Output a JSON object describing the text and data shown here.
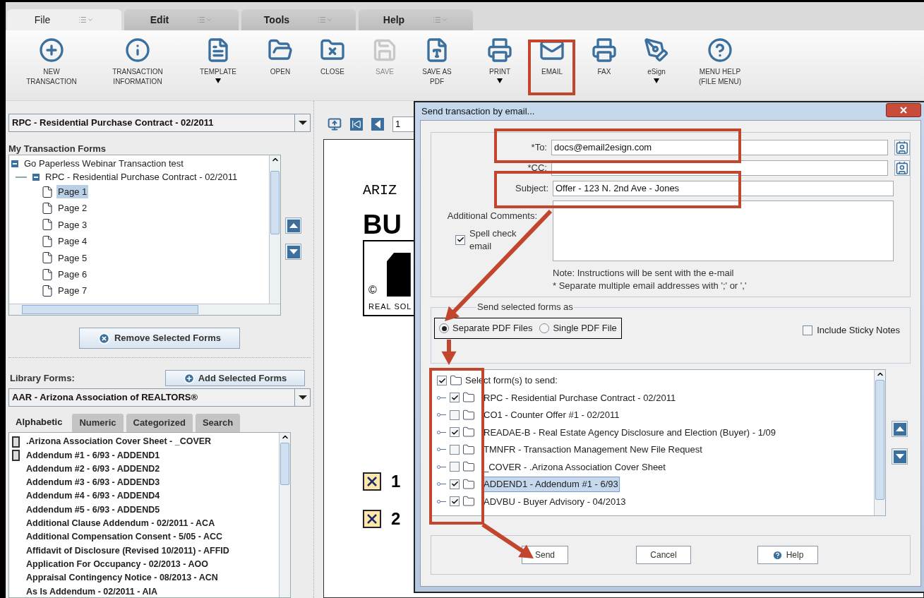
{
  "menu_tabs": [
    {
      "label": "File",
      "selected": true
    },
    {
      "label": "Edit",
      "selected": false
    },
    {
      "label": "Tools",
      "selected": false
    },
    {
      "label": "Help",
      "selected": false
    }
  ],
  "toolbar": [
    {
      "kind": "new",
      "label": "NEW\nTRANSACTION",
      "dropdown": false,
      "disabled": false
    },
    {
      "kind": "info",
      "label": "TRANSACTION\nINFORMATION",
      "dropdown": false,
      "disabled": false
    },
    {
      "kind": "template",
      "label": "TEMPLATE",
      "dropdown": true,
      "disabled": false
    },
    {
      "kind": "open",
      "label": "OPEN",
      "dropdown": false,
      "disabled": false
    },
    {
      "kind": "close",
      "label": "CLOSE",
      "dropdown": false,
      "disabled": false
    },
    {
      "kind": "save",
      "label": "SAVE",
      "dropdown": false,
      "disabled": true
    },
    {
      "kind": "pdf",
      "label": "SAVE AS\nPDF",
      "dropdown": false,
      "disabled": false
    },
    {
      "kind": "print",
      "label": "PRINT",
      "dropdown": true,
      "disabled": false
    },
    {
      "kind": "email",
      "label": "EMAIL",
      "dropdown": false,
      "disabled": false
    },
    {
      "kind": "fax",
      "label": "FAX",
      "dropdown": false,
      "disabled": false
    },
    {
      "kind": "esign",
      "label": "eSign",
      "dropdown": true,
      "disabled": false
    },
    {
      "kind": "help",
      "label": "MENU HELP\n(FILE MENU)",
      "dropdown": false,
      "disabled": false
    }
  ],
  "form_selector": {
    "value": "RPC - Residential Purchase Contract - 02/2011"
  },
  "transaction_forms": {
    "title": "My Transaction Forms",
    "tree": [
      {
        "label": "Go Paperless Webinar Transaction test",
        "expanded": true,
        "children": [
          {
            "label": "RPC - Residential Purchase Contract - 02/2011",
            "expanded": true,
            "children": [
              {
                "label": "Page 1",
                "selected": true
              },
              {
                "label": "Page 2",
                "selected": false
              },
              {
                "label": "Page 3",
                "selected": false
              },
              {
                "label": "Page 4",
                "selected": false
              },
              {
                "label": "Page 5",
                "selected": false
              },
              {
                "label": "Page 6",
                "selected": false
              },
              {
                "label": "Page 7",
                "selected": false
              }
            ]
          }
        ]
      }
    ],
    "remove_button": "Remove Selected Forms"
  },
  "library": {
    "label": "Library Forms:",
    "add_button": "Add Selected Forms",
    "selector": "AAR - Arizona Association of REALTORS®",
    "tabs": [
      {
        "label": "Alphabetic",
        "selected": true
      },
      {
        "label": "Numeric",
        "selected": false
      },
      {
        "label": "Categorized",
        "selected": false
      },
      {
        "label": "Search",
        "selected": false
      }
    ],
    "items": [
      {
        "label": ".Arizona Association Cover Sheet - _COVER",
        "marked": true
      },
      {
        "label": "Addendum #1 - 6/93 - ADDEND1",
        "marked": true
      },
      {
        "label": "Addendum #2 - 6/93 - ADDEND2",
        "marked": false
      },
      {
        "label": "Addendum #3 - 6/93 - ADDEND3",
        "marked": false
      },
      {
        "label": "Addendum #4 - 6/93 - ADDEND4",
        "marked": false
      },
      {
        "label": "Addendum #5 - 6/93 - ADDEND5",
        "marked": false
      },
      {
        "label": "Additional Clause Addendum - 02/2011 - ACA",
        "marked": false
      },
      {
        "label": "Additional Compensation Consent - 5/05 - ACC",
        "marked": false
      },
      {
        "label": "Affidavit of Disclosure (Revised 10/2011) - AFFID",
        "marked": false
      },
      {
        "label": "Application For Occupancy - 02/2013 - AOO",
        "marked": false
      },
      {
        "label": "Appraisal Contingency Notice - 08/2013 - ACN",
        "marked": false
      },
      {
        "label": "As Is Addendum - 02/2011 - AIA",
        "marked": false
      }
    ]
  },
  "document": {
    "page_field": "1",
    "heading": "ARIZ",
    "title": "BU",
    "copyright": "©",
    "logo_text": "REAL SOL",
    "items": [
      {
        "number": "1",
        "checked": true
      },
      {
        "number": "2",
        "checked": true
      }
    ]
  },
  "dialog": {
    "title": "Send transaction by email...",
    "to": {
      "label": "*To:",
      "value": "docs@email2esign.com"
    },
    "cc": {
      "label": "*CC:"
    },
    "subject": {
      "label": "Subject:",
      "value": "Offer - 123 N. 2nd Ave - Jones"
    },
    "comments_label": "Additional Comments:",
    "spell_check": {
      "label": "Spell check email",
      "checked": true
    },
    "notes": [
      "Note: Instructions will be sent with the e-mail",
      "* Separate multiple email addresses with ';' or ','"
    ],
    "send_as": {
      "legend": "Send selected forms as",
      "options": [
        {
          "label": "Separate PDF Files",
          "selected": true
        },
        {
          "label": "Single PDF File",
          "selected": false
        }
      ],
      "sticky_notes": {
        "label": "Include Sticky Notes",
        "checked": false
      }
    },
    "forms": {
      "header": {
        "label": "Select form(s) to send:",
        "checked": true
      },
      "items": [
        {
          "label": "RPC - Residential Purchase Contract - 02/2011",
          "checked": true,
          "selected": false
        },
        {
          "label": "CO1 - Counter Offer #1 - 02/2011",
          "checked": false,
          "selected": false
        },
        {
          "label": "READAE-B - Real Estate Agency Disclosure and Election (Buyer) - 1/09",
          "checked": true,
          "selected": false
        },
        {
          "label": "TMNFR - Transaction Management New File Request",
          "checked": false,
          "selected": false
        },
        {
          "label": "_COVER - .Arizona Association Cover Sheet",
          "checked": false,
          "selected": false
        },
        {
          "label": "ADDEND1 - Addendum #1 - 6/93",
          "checked": true,
          "selected": true
        },
        {
          "label": "ADVBU - Buyer Advisory - 04/2013",
          "checked": true,
          "selected": false
        }
      ]
    },
    "buttons": [
      {
        "kind": "send",
        "label": "Send"
      },
      {
        "kind": "cancel",
        "label": "Cancel"
      },
      {
        "kind": "help",
        "label": "Help"
      }
    ]
  }
}
